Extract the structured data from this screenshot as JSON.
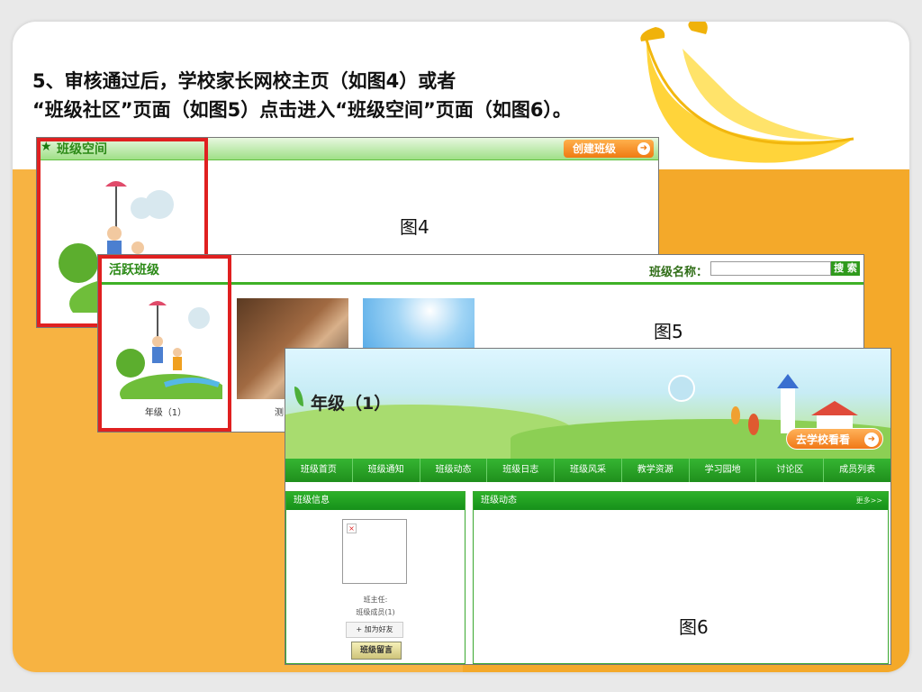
{
  "heading": {
    "line1": "5、审核通过后，学校家长网校主页（如图4）或者",
    "line2": "“班级社区”页面（如图5）点击进入“班级空间”页面（如图6）。"
  },
  "fig4": {
    "label": "图4",
    "bar_title": "班级空间",
    "create_button": "创建班级"
  },
  "fig5": {
    "label": "图5",
    "bar_title": "活跃班级",
    "search_label": "班级名称：",
    "search_value": "",
    "search_button": "搜 索",
    "caption1": "年级（1）",
    "caption2": "测"
  },
  "fig6": {
    "label": "图6",
    "class_name": "年级（1）",
    "go_school": "去学校看看",
    "nav": [
      "班级首页",
      "班级通知",
      "班级动态",
      "班级日志",
      "班级风采",
      "教学资源",
      "学习园地",
      "讨论区",
      "成员列表"
    ],
    "left_panel_title": "班级信息",
    "right_panel_title": "班级动态",
    "more": "更多>>",
    "head_teacher": "班主任:",
    "members": "班级成员(1)",
    "add_friend": "+ 加为好友",
    "leave_message": "班级留言"
  },
  "colors": {
    "accent_orange": "#f7b342",
    "green": "#2f9a1c",
    "red_frame": "#e02020"
  }
}
